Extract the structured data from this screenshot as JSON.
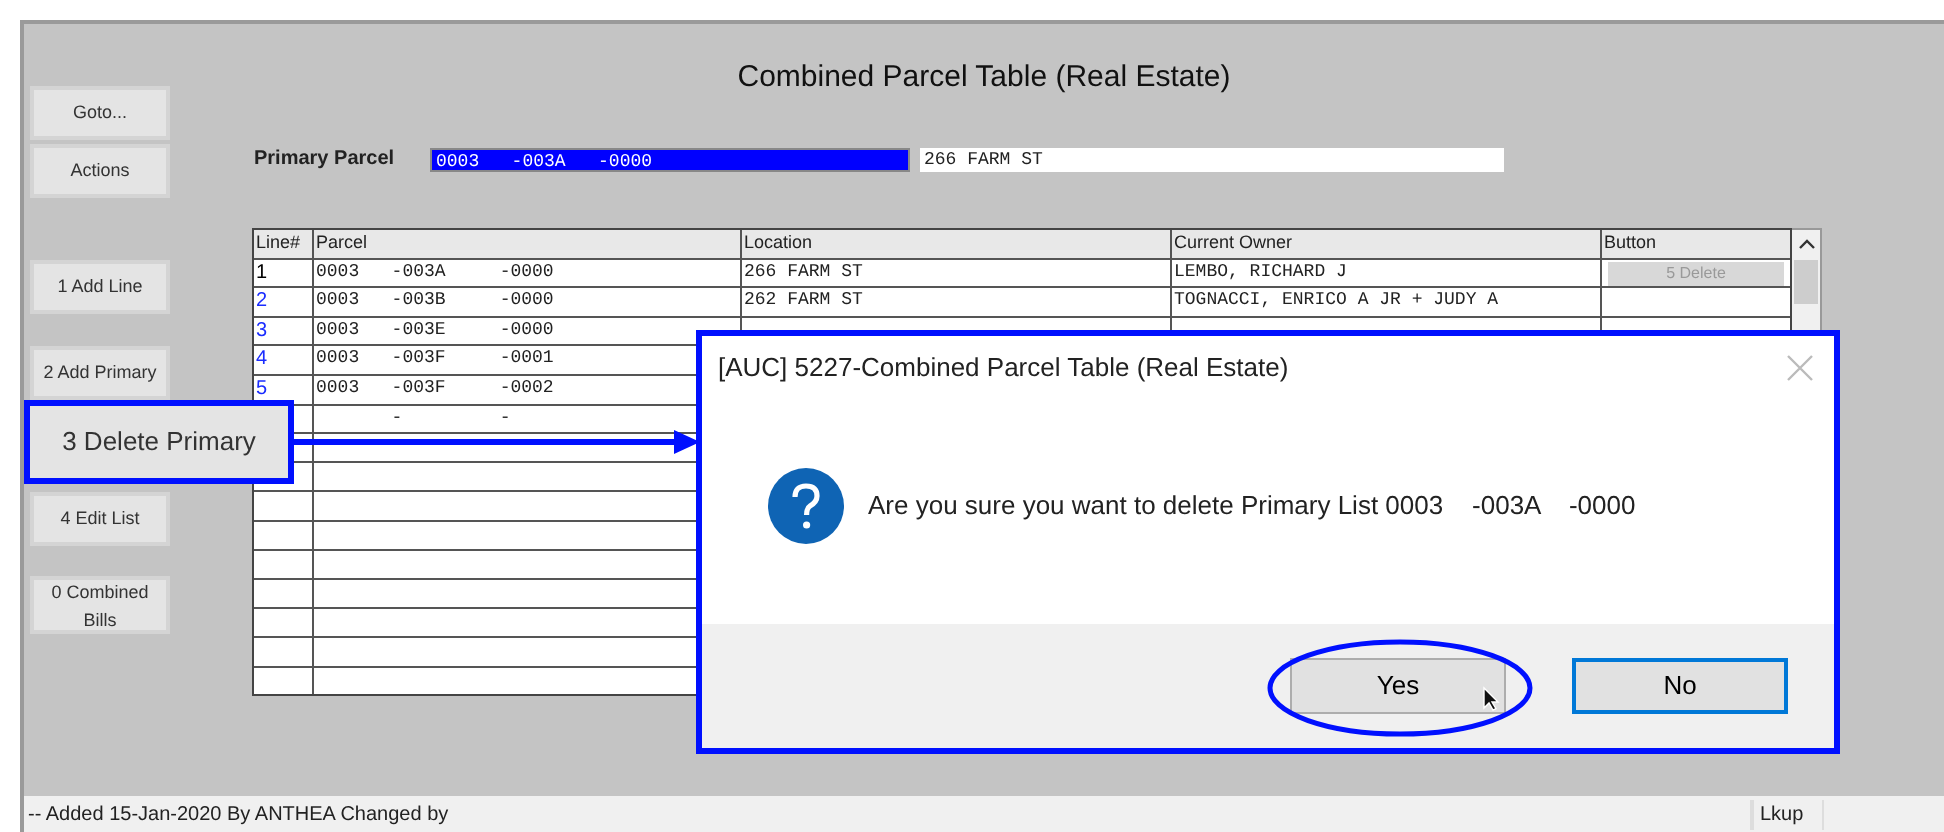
{
  "window": {
    "title": "Combined Parcel Table (Real Estate)"
  },
  "side_buttons": [
    {
      "label": "Goto...",
      "highlighted": false
    },
    {
      "label": "Actions",
      "highlighted": false
    },
    {
      "label": "1 Add Line",
      "highlighted": false
    },
    {
      "label": "2 Add Primary",
      "highlighted": false
    },
    {
      "label": "3 Delete Primary",
      "highlighted": true
    },
    {
      "label": "4 Edit List",
      "highlighted": false
    },
    {
      "label": "0 Combined Bills",
      "highlighted": false
    }
  ],
  "primary_parcel": {
    "label": "Primary Parcel",
    "value": "0003   -003A   -0000",
    "location": "266 FARM ST"
  },
  "table": {
    "columns": [
      "Line#",
      "Parcel",
      "Location",
      "Current Owner",
      "Button"
    ],
    "rows": [
      {
        "line": "1",
        "selected": true,
        "parcel": "0003   -003A     -0000",
        "location": "266 FARM ST",
        "owner": "LEMBO, RICHARD J",
        "button": {
          "label": "5 Delete",
          "disabled": true
        }
      },
      {
        "line": "2",
        "selected": false,
        "parcel": "0003   -003B     -0000",
        "location": "262 FARM ST",
        "owner": "TOGNACCI, ENRICO A JR + JUDY A"
      },
      {
        "line": "3",
        "selected": false,
        "parcel": "0003   -003E     -0000"
      },
      {
        "line": "4",
        "selected": false,
        "parcel": "0003   -003F     -0001"
      },
      {
        "line": "5",
        "selected": false,
        "parcel": "0003   -003F     -0002"
      },
      {
        "parcel": "       -         -"
      }
    ]
  },
  "dialog": {
    "title": "[AUC] 5227-Combined Parcel Table (Real Estate)",
    "message": "Are you sure you want to delete Primary List 0003    -003A    -0000",
    "buttons": [
      {
        "label": "Yes",
        "focused": false,
        "circled": true
      },
      {
        "label": "No",
        "focused": true,
        "circled": false
      }
    ]
  },
  "status_bar": {
    "text": "-- Added 15-Jan-2020 By ANTHEA Changed  by",
    "right": "Lkup"
  }
}
